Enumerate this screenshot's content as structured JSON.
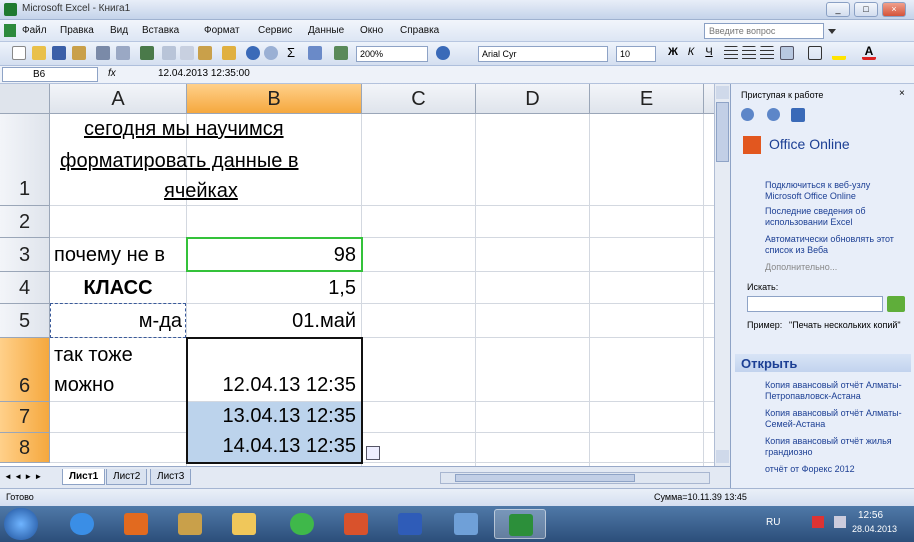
{
  "window": {
    "title": "Microsoft Excel - Книга1",
    "min": "_",
    "max": "□",
    "close": "×"
  },
  "menu": {
    "items": [
      "Файл",
      "Правка",
      "Вид",
      "Вставка",
      "Формат",
      "Сервис",
      "Данные",
      "Окно",
      "Справка"
    ],
    "help_placeholder": "Введите вопрос"
  },
  "toolbar": {
    "zoom": "200%",
    "font": "Arial Cyr",
    "size": "10",
    "bold": "Ж",
    "italic": "К",
    "underline": "Ч"
  },
  "formula_bar": {
    "name_box": "B6",
    "fx": "fx",
    "value": "12.04.2013  12:35:00"
  },
  "columns": [
    "A",
    "B",
    "C",
    "D",
    "E"
  ],
  "rows": [
    "1",
    "2",
    "3",
    "4",
    "5",
    "6",
    "7",
    "8"
  ],
  "cells": {
    "a1_line1": "сегодня мы научимся",
    "a1_line2": "форматировать данные в",
    "a1_line3": "ячейках",
    "a3": "почему не в",
    "b3": "98",
    "a4": "КЛАСС",
    "b4": "1,5",
    "a5": "м-да",
    "b5": "01.май",
    "a6_line1": "так тоже",
    "a6_line2": "можно",
    "b6": "12.04.13 12:35",
    "b7": "13.04.13 12:35",
    "b8": "14.04.13 12:35"
  },
  "sheets": {
    "tabs": [
      "Лист1",
      "Лист2",
      "Лист3"
    ],
    "active": "Лист1"
  },
  "task_pane": {
    "title": "Приступая к работе",
    "office_online": "Office Online",
    "links": [
      "Подключиться к веб-узлу Microsoft Office Online",
      "Последние сведения об использовании Excel",
      "Автоматически обновлять этот список из Веба"
    ],
    "more": "Дополнительно...",
    "search_label": "Искать:",
    "example_label": "Пример:",
    "example_text": "\"Печать нескольких копий\"",
    "open_header": "Открыть",
    "files": [
      "Копия авансовый отчёт Алматы-Петропавловск-Астана",
      "Копия авансовый отчёт Алматы-Семей-Астана",
      "Копия авансовый отчёт жилья грандиозно",
      "отчёт от Форекс 2012"
    ]
  },
  "status": {
    "ready": "Готово",
    "sum": "Сумма=10.11.39 13:45"
  },
  "taskbar": {
    "lang": "RU",
    "time": "12:56",
    "date": "28.04.2013"
  },
  "colors": {
    "selected_header": "#f5a83e",
    "selection_fill": "#bcd3ec",
    "active_border": "#34c23a",
    "pane_link": "#1c3f94"
  }
}
